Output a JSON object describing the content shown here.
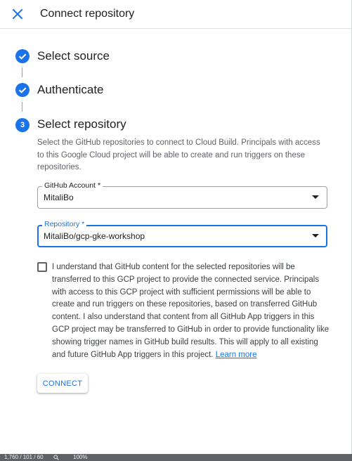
{
  "header": {
    "title": "Connect repository"
  },
  "steps": [
    {
      "title": "Select source",
      "status": "complete"
    },
    {
      "title": "Authenticate",
      "status": "complete"
    },
    {
      "title": "Select repository",
      "number": "3",
      "status": "active"
    }
  ],
  "description": "Select the GitHub repositories to connect to Cloud Build. Principals with access to this Google Cloud project will be able to create and run triggers on these repositories.",
  "github_account": {
    "label": "GitHub Account *",
    "value": "MitaliBo"
  },
  "repository": {
    "label": "Repository *",
    "value": "MitaliBo/gcp-gke-workshop"
  },
  "consent": {
    "checked": false,
    "text": "I understand that GitHub content for the selected repositories will be transferred to this GCP project to provide the connected service. Principals with access to this GCP project with sufficient permissions will be able to create and run triggers on these repositories, based on transferred GitHub content. I also understand that content from all GitHub App triggers in this GCP project may be transferred to GitHub in order to provide functionality like showing trigger names in GitHub build results. This will apply to all existing and future GitHub App triggers in this project.",
    "link_label": "Learn more"
  },
  "connect_button": {
    "label": "CONNECT"
  },
  "statusbar": {
    "left_text": "1,760 / 101 / 60",
    "zoom": "100%"
  },
  "colors": {
    "accent": "#1a73e8",
    "text": "#202124",
    "muted": "#5f6368",
    "border": "#9aa0a6"
  },
  "icons": {
    "close": "close-icon",
    "complete": "check-circle-icon",
    "dropdown": "dropdown-arrow-icon",
    "zoom": "magnifier-icon"
  }
}
